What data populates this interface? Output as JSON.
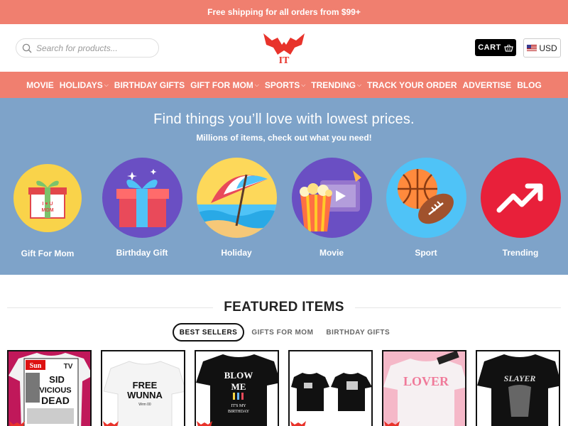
{
  "topbar": {
    "text": "Free shipping for all orders from $99+"
  },
  "header": {
    "search_placeholder": "Search for products...",
    "cart_label": "CART",
    "currency_label": "USD",
    "logo_text": "IT"
  },
  "nav": {
    "items": [
      {
        "label": "MOVIE",
        "dropdown": false
      },
      {
        "label": "HOLIDAYS",
        "dropdown": true
      },
      {
        "label": "BIRTHDAY GIFTS",
        "dropdown": false
      },
      {
        "label": "GIFT FOR MOM",
        "dropdown": true
      },
      {
        "label": "SPORTS",
        "dropdown": true
      },
      {
        "label": "TRENDING",
        "dropdown": true
      },
      {
        "label": "TRACK YOUR ORDER",
        "dropdown": false
      },
      {
        "label": "ADVERTISE",
        "dropdown": false
      },
      {
        "label": "BLOG",
        "dropdown": false
      }
    ]
  },
  "hero": {
    "title": "Find things you’ll love with lowest prices.",
    "subtitle": "Millions of items, check out what you need!",
    "categories": [
      {
        "label": "Gift For Mom",
        "icon": "gift-mom-icon",
        "gift_text": "I ♥ U MOM"
      },
      {
        "label": "Birthday Gift",
        "icon": "birthday-gift-icon"
      },
      {
        "label": "Holiday",
        "icon": "beach-umbrella-icon"
      },
      {
        "label": "Movie",
        "icon": "movie-popcorn-icon"
      },
      {
        "label": "Sport",
        "icon": "sports-balls-icon"
      },
      {
        "label": "Trending",
        "icon": "trending-arrow-icon"
      }
    ]
  },
  "featured": {
    "title": "FEATURED ITEMS",
    "tabs": [
      {
        "label": "BEST SELLERS",
        "active": true
      },
      {
        "label": "GIFTS FOR MOM",
        "active": false
      },
      {
        "label": "BIRTHDAY GIFTS",
        "active": false
      }
    ]
  },
  "products": [
    {
      "name": "sid-vicious-shirt",
      "shirt_color": "#f2f2f2",
      "bg": "#c0185a",
      "print": [
        "The",
        "Sun",
        "SID",
        "VICIOUS",
        "DEAD",
        "TV"
      ]
    },
    {
      "name": "free-wunna-shirt",
      "shirt_color": "#f4f4f4",
      "bg": "#ffffff",
      "print": [
        "FREE",
        "WUNNA",
        "Wrm 00"
      ]
    },
    {
      "name": "blow-me-shirt",
      "shirt_color": "#111111",
      "bg": "#ffffff",
      "print": [
        "BLOW",
        "ME",
        "IT'S MY",
        "BIRTHDAY"
      ]
    },
    {
      "name": "two-black-shirts",
      "shirt_color": "#111111",
      "bg": "#ffffff",
      "print": []
    },
    {
      "name": "lover-shirt",
      "shirt_color": "#f6f0f2",
      "bg": "#f5b8c8",
      "print": [
        "LOVER"
      ]
    },
    {
      "name": "slayer-shirt",
      "shirt_color": "#111111",
      "bg": "#ffffff",
      "print": [
        "SLAYER"
      ]
    }
  ],
  "colors": {
    "accent": "#f07f6f",
    "hero_bg": "#7ea3c9",
    "logo_red": "#e8332b"
  }
}
